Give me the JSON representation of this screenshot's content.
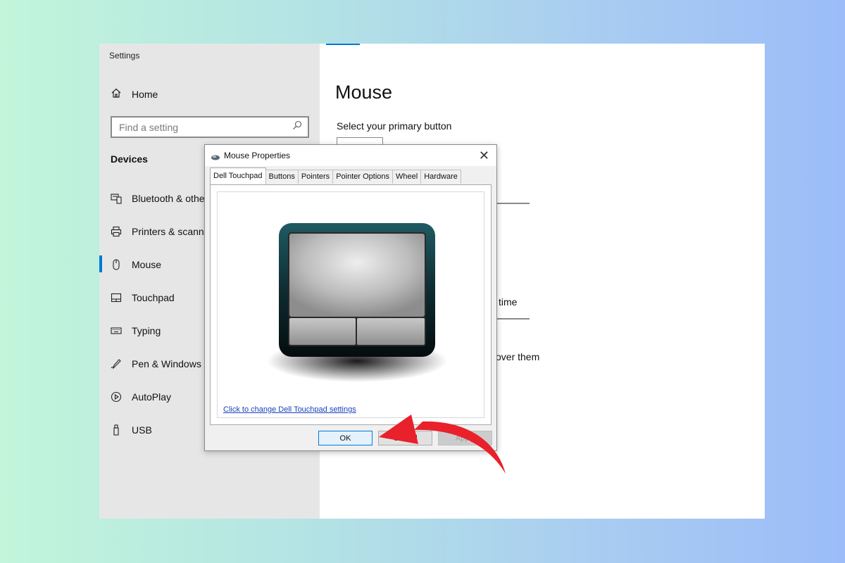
{
  "settings": {
    "window_title": "Settings",
    "home_label": "Home",
    "search_placeholder": "Find a setting",
    "section_heading": "Devices",
    "nav_items": [
      {
        "label": "Bluetooth & othe",
        "icon": "bluetooth-devices-icon"
      },
      {
        "label": "Printers & scanne",
        "icon": "printer-icon"
      },
      {
        "label": "Mouse",
        "icon": "mouse-icon",
        "active": true
      },
      {
        "label": "Touchpad",
        "icon": "touchpad-icon"
      },
      {
        "label": "Typing",
        "icon": "keyboard-icon"
      },
      {
        "label": "Pen & Windows I",
        "icon": "pen-icon"
      },
      {
        "label": "AutoPlay",
        "icon": "autoplay-icon"
      },
      {
        "label": "USB",
        "icon": "usb-icon"
      }
    ],
    "main": {
      "title": "Mouse",
      "primary_button_label": "Select your primary button",
      "fragment_time": "time",
      "fragment_over_them": "over them"
    },
    "accent_color": "#0078d4"
  },
  "dialog": {
    "title": "Mouse Properties",
    "close_glyph": "✕",
    "tabs": [
      "Dell Touchpad",
      "Buttons",
      "Pointers",
      "Pointer Options",
      "Wheel",
      "Hardware"
    ],
    "active_tab": "Dell Touchpad",
    "link_text": "Click to change Dell Touchpad settings",
    "buttons": {
      "ok": "OK",
      "cancel": "Cancel",
      "apply": "Apply"
    }
  },
  "annotation": {
    "arrow_color": "#e8212b",
    "points_to": "OK"
  }
}
